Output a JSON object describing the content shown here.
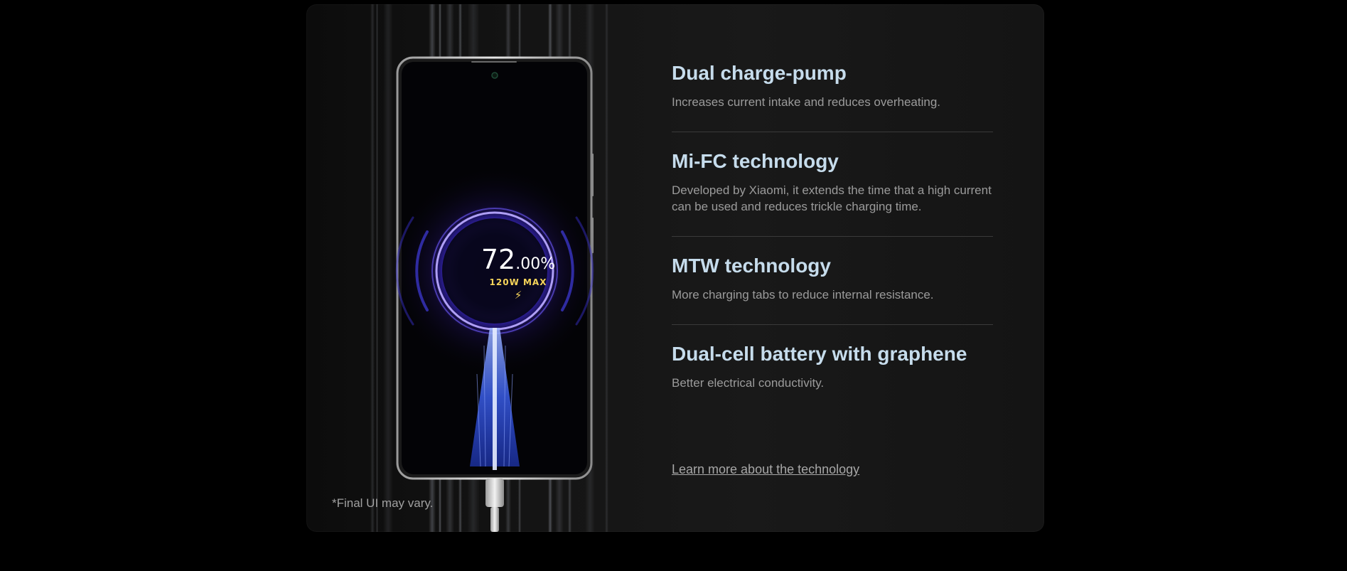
{
  "hero": {
    "battery_percent_whole": "72",
    "battery_percent_decimal": ".00%",
    "wattage_label": "120W MAX",
    "bolt_icon": "lightning-bolt-icon"
  },
  "features": [
    {
      "title": "Dual charge-pump",
      "description": "Increases current intake and reduces overheating."
    },
    {
      "title": "Mi-FC technology",
      "description": "Developed by Xiaomi, it extends the time that a high current can be used and reduces trickle charging time."
    },
    {
      "title": "MTW technology",
      "description": "More charging tabs to reduce internal resistance."
    },
    {
      "title": "Dual-cell battery with graphene",
      "description": "Better electrical conductivity."
    }
  ],
  "learn_more_link": "Learn more about the technology",
  "disclaimer": "*Final UI may vary.",
  "colors": {
    "page_background": "#000000",
    "card_background": "#161616",
    "feature_title": "#c6dcec",
    "feature_description": "#9b9b9b",
    "wattage_accent": "#f6d45a",
    "charge_glow": "#6a3cff"
  }
}
